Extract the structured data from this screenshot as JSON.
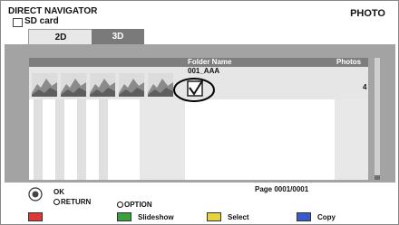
{
  "header": {
    "title": "DIRECT NAVIGATOR",
    "mode": "PHOTO",
    "source": "SD card"
  },
  "tabs": [
    {
      "label": "2D",
      "active": true
    },
    {
      "label": "3D",
      "active": false
    }
  ],
  "table": {
    "col_folder": "Folder Name",
    "col_photos": "Photos",
    "rows": [
      {
        "folder": "001_AAA",
        "photos": "4",
        "checked": true
      }
    ]
  },
  "nav": {
    "ok": "OK",
    "return": "RETURN",
    "option": "OPTION"
  },
  "page": "Page  0001/0001",
  "footer": [
    {
      "color": "#d93a3a",
      "label": ""
    },
    {
      "color": "#3aa03a",
      "label": "Slideshow"
    },
    {
      "color": "#e6d23a",
      "label": "Select"
    },
    {
      "color": "#3a5ac8",
      "label": "Copy"
    }
  ],
  "icons": {
    "check": "checkbox-checked-icon",
    "nav": "navigation-ring-icon",
    "card": "sd-card-icon"
  }
}
